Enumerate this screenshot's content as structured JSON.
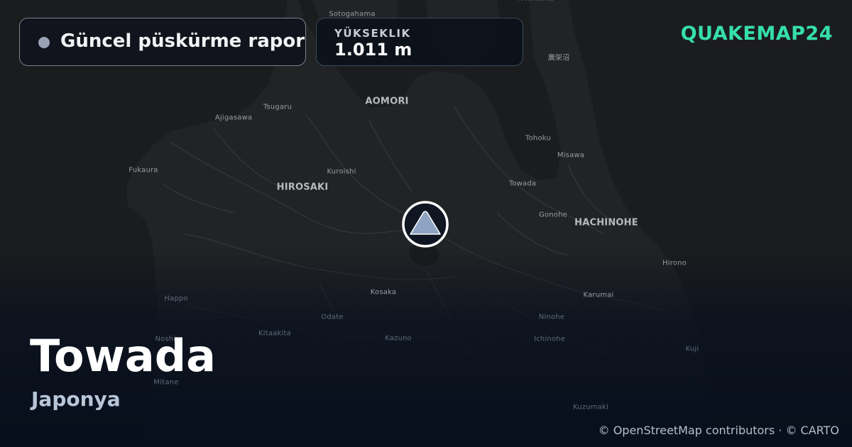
{
  "status": {
    "label": "Güncel püskürme raporu"
  },
  "elevation": {
    "label": "YÜKSEKLIK",
    "value": "1.011 m"
  },
  "brand": {
    "name": "QUAKEMAP24"
  },
  "location": {
    "name": "Towada",
    "country": "Japonya"
  },
  "attribution": "© OpenStreetMap contributors · © CARTO",
  "map": {
    "places": [
      {
        "name": "Sotogahama",
        "kind": "town"
      },
      {
        "name": "Yokohama",
        "kind": "town"
      },
      {
        "name": "廣架沼",
        "kind": "town"
      },
      {
        "name": "AOMORI",
        "kind": "city"
      },
      {
        "name": "Tsugaru",
        "kind": "town"
      },
      {
        "name": "Ajigasawa",
        "kind": "town"
      },
      {
        "name": "Tohoku",
        "kind": "town"
      },
      {
        "name": "Misawa",
        "kind": "town"
      },
      {
        "name": "Fukaura",
        "kind": "town"
      },
      {
        "name": "Kuroishi",
        "kind": "town"
      },
      {
        "name": "HIROSAKI",
        "kind": "city"
      },
      {
        "name": "Towada",
        "kind": "town"
      },
      {
        "name": "Gonohe",
        "kind": "town"
      },
      {
        "name": "HACHINOHE",
        "kind": "city"
      },
      {
        "name": "Hirono",
        "kind": "town"
      },
      {
        "name": "Happo",
        "kind": "dim"
      },
      {
        "name": "Kosaka",
        "kind": "town"
      },
      {
        "name": "Karumai",
        "kind": "town"
      },
      {
        "name": "Odate",
        "kind": "dim"
      },
      {
        "name": "Ninohe",
        "kind": "dim"
      },
      {
        "name": "Kitaakita",
        "kind": "dim"
      },
      {
        "name": "Kazuno",
        "kind": "dim"
      },
      {
        "name": "Ichinohe",
        "kind": "dim"
      },
      {
        "name": "Noshiro",
        "kind": "dim"
      },
      {
        "name": "Kuji",
        "kind": "dim"
      },
      {
        "name": "Mitane",
        "kind": "dim"
      },
      {
        "name": "Kuzumaki",
        "kind": "dim"
      }
    ],
    "colors": {
      "land": "#222325",
      "sea": "#1b1c1e",
      "rivers": "#3a3b3e",
      "lake": "#1a1b1d"
    }
  },
  "marker": {
    "icon": "volcano-icon",
    "color": "#8ea4c2"
  }
}
